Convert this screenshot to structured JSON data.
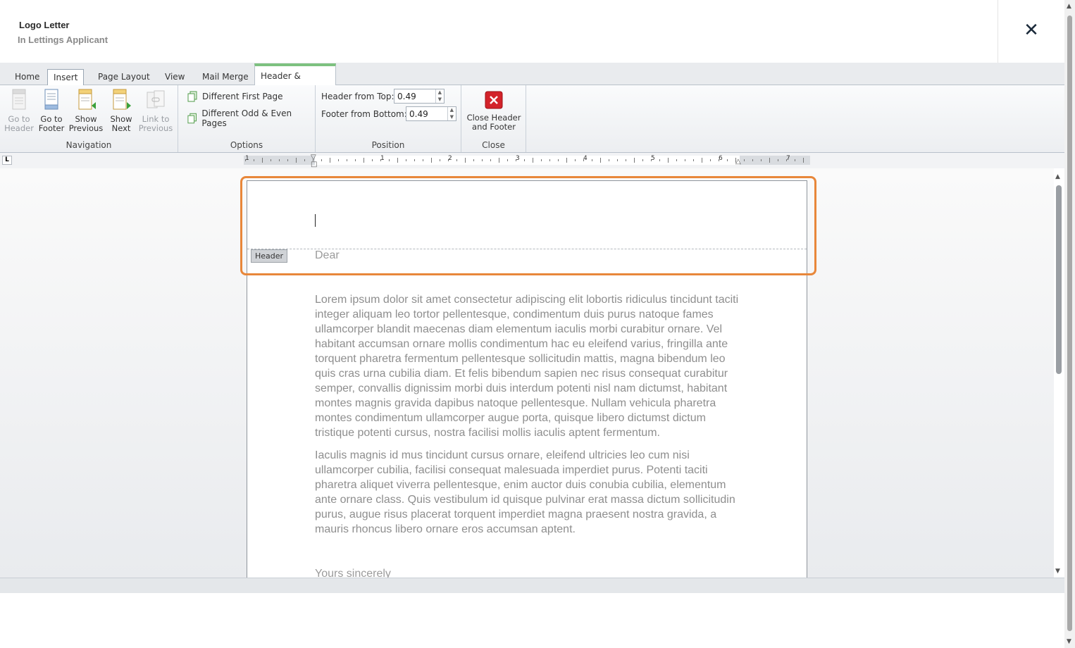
{
  "window": {
    "title": "Logo Letter",
    "subtitle": "In Lettings Applicant",
    "close_icon": "✕"
  },
  "ribbon": {
    "tabs": [
      "Home",
      "Insert",
      "Page Layout",
      "View",
      "Mail Merge",
      "Header & Footer"
    ],
    "selected_tab": "Insert",
    "active_context_tab": "Header & Footer",
    "context_tab_color": "#7dc17f",
    "collapse_icon": "^",
    "navigation": {
      "label": "Navigation",
      "go_to_header": {
        "line1": "Go to",
        "line2": "Header",
        "enabled": false
      },
      "go_to_footer": {
        "line1": "Go to",
        "line2": "Footer",
        "enabled": true
      },
      "show_previous": {
        "line1": "Show",
        "line2": "Previous",
        "enabled": true
      },
      "show_next": {
        "line1": "Show",
        "line2": "Next",
        "enabled": true
      },
      "link_to_previous": {
        "line1": "Link to",
        "line2": "Previous",
        "enabled": false
      }
    },
    "options": {
      "label": "Options",
      "different_first_page": "Different First Page",
      "different_odd_even": "Different Odd & Even Pages"
    },
    "position": {
      "label": "Position",
      "header_from_top_label": "Header from Top:",
      "header_from_top_value": "0.49",
      "footer_from_bottom_label": "Footer from Bottom:",
      "footer_from_bottom_value": "0.49"
    },
    "close": {
      "label": "Close",
      "button_line1": "Close Header",
      "button_line2": "and Footer"
    }
  },
  "ruler": {
    "tab_selector": "L",
    "numbers": [
      "1",
      "1",
      "2",
      "3",
      "4",
      "5",
      "6",
      "7"
    ]
  },
  "document": {
    "header_tag": "Header",
    "greeting": "Dear",
    "paragraphs": [
      "Lorem ipsum dolor sit amet consectetur adipiscing elit lobortis ridiculus tincidunt taciti integer aliquam leo tortor pellentesque, condimentum duis purus natoque fames ullamcorper blandit maecenas diam elementum iaculis morbi curabitur ornare. Vel habitant accumsan ornare mollis condimentum hac eu eleifend varius, fringilla ante torquent pharetra fermentum pellentesque sollicitudin mattis, magna bibendum leo quis cras urna cubilia diam. Et felis bibendum sapien nec risus consequat curabitur semper, convallis dignissim morbi duis interdum potenti nisl nam dictumst, habitant montes magnis gravida dapibus natoque pellentesque. Nullam vehicula pharetra montes condimentum ullamcorper augue porta, quisque libero dictumst dictum tristique potenti cursus, nostra facilisi mollis iaculis aptent fermentum.",
      "Iaculis magnis id mus tincidunt cursus ornare, eleifend ultricies leo cum nisi ullamcorper cubilia, facilisi consequat malesuada imperdiet purus. Potenti taciti pharetra aliquet viverra pellentesque, enim auctor duis conubia cubilia, elementum ante ornare class. Quis vestibulum id quisque pulvinar erat massa dictum sollicitudin purus, augue risus placerat torquent imperdiet magna praesent nostra gravida, a mauris rhoncus libero ornare eros accumsan aptent."
    ],
    "signoff": "Yours sincerely",
    "highlight_color": "#e8873a"
  }
}
